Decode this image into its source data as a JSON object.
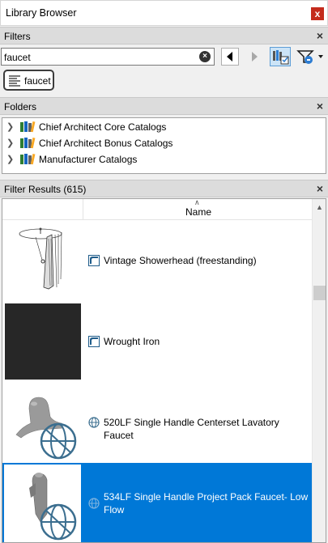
{
  "window": {
    "title": "Library Browser",
    "close": "x"
  },
  "filters": {
    "header": "Filters",
    "close": "×",
    "search_value": "faucet",
    "clear": "×",
    "chip_label": "faucet"
  },
  "folders": {
    "header": "Folders",
    "close": "×",
    "items": [
      {
        "label": "Chief Architect Core Catalogs"
      },
      {
        "label": "Chief Architect Bonus Catalogs"
      },
      {
        "label": "Manufacturer Catalogs"
      }
    ]
  },
  "results": {
    "header": "Filter Results (615)",
    "close": "×",
    "column_name": "Name",
    "items": [
      {
        "label": "Vintage Showerhead (freestanding)",
        "selected": false
      },
      {
        "label": "Wrought Iron",
        "selected": false
      },
      {
        "label": "520LF Single Handle Centerset Lavatory Faucet",
        "selected": false
      },
      {
        "label": "534LF Single Handle Project Pack Faucet- Low Flow",
        "selected": true
      }
    ]
  },
  "colors": {
    "selection": "#0078d7",
    "close_button": "#c42b1c",
    "header_bg": "#dcdcdc"
  }
}
